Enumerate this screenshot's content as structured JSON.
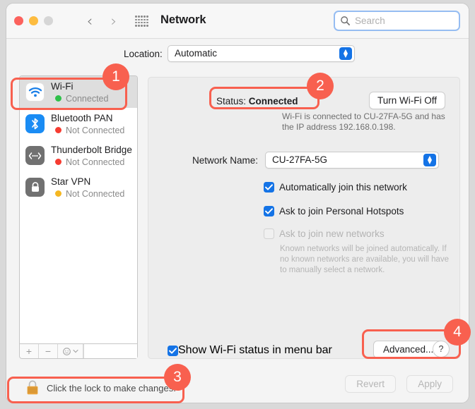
{
  "window": {
    "title": "Network",
    "traffic_lights": [
      "close",
      "minimize",
      "zoom"
    ],
    "nav": {
      "back": "‹",
      "forward": "›"
    },
    "grid_icon": "grid-apps-icon"
  },
  "search": {
    "placeholder": "Search",
    "value": "",
    "icon": "search-icon"
  },
  "location": {
    "label": "Location:",
    "value": "Automatic"
  },
  "sidebar": {
    "services": [
      {
        "name": "Wi-Fi",
        "status": "Connected",
        "status_color": "#2fc04a",
        "icon": "wifi-icon",
        "selected": true
      },
      {
        "name": "Bluetooth PAN",
        "status": "Not Connected",
        "status_color": "#f63c31",
        "icon": "bluetooth-icon",
        "selected": false
      },
      {
        "name": "Thunderbolt Bridge",
        "status": "Not Connected",
        "status_color": "#f63c31",
        "icon": "thunderbolt-icon",
        "selected": false
      },
      {
        "name": "Star VPN",
        "status": "Not Connected",
        "status_color": "#f5b722",
        "icon": "lock-icon",
        "selected": false
      }
    ],
    "footer": {
      "add": "+",
      "remove": "−",
      "actions": "gear-icon",
      "chevron": "chevron-down-icon"
    }
  },
  "panel": {
    "status_label": "Status:",
    "status_value": "Connected",
    "turn_off_button": "Turn Wi-Fi Off",
    "status_description": "Wi-Fi is connected to CU-27FA-5G and has the IP address 192.168.0.198.",
    "network_name_label": "Network Name:",
    "network_name_value": "CU-27FA-5G",
    "checkboxes": [
      {
        "label": "Automatically join this network",
        "checked": true,
        "enabled": true
      },
      {
        "label": "Ask to join Personal Hotspots",
        "checked": true,
        "enabled": true
      },
      {
        "label": "Ask to join new networks",
        "checked": false,
        "enabled": false
      }
    ],
    "help_text": "Known networks will be joined automatically. If no known networks are available, you will have to manually select a network.",
    "menubar_checkbox": {
      "label": "Show Wi-Fi status in menu bar",
      "checked": true
    },
    "advanced_button": "Advanced...",
    "help_button": "?"
  },
  "bottom": {
    "lock_icon": "padlock-closed-icon",
    "lock_text": "Click the lock to make changes.",
    "revert_button": "Revert",
    "apply_button": "Apply"
  },
  "annotations": {
    "accent_color": "#f8604f",
    "badges": [
      "1",
      "2",
      "3",
      "4"
    ]
  }
}
